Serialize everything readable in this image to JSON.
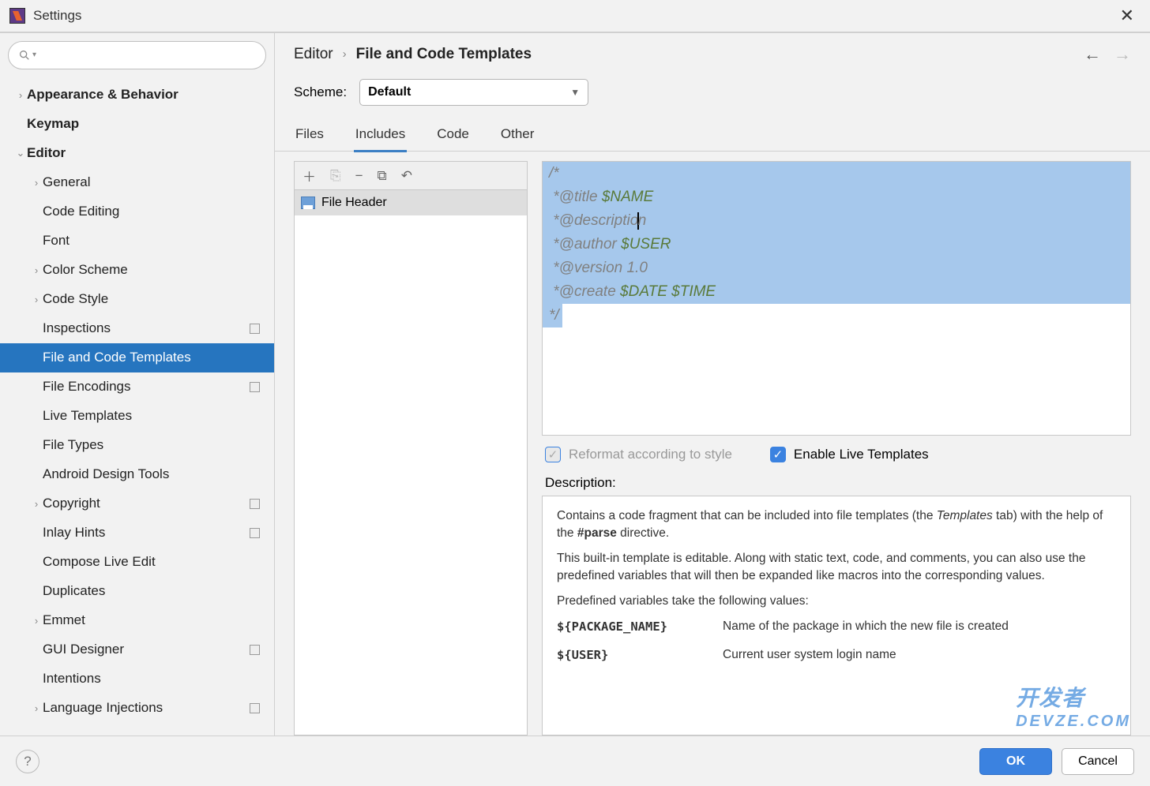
{
  "window": {
    "title": "Settings"
  },
  "search": {
    "placeholder": ""
  },
  "sidebar": {
    "items": [
      {
        "label": "Appearance & Behavior",
        "level": 0,
        "bold": true,
        "arrow": "›",
        "name": "appearance-behavior"
      },
      {
        "label": "Keymap",
        "level": 0,
        "bold": true,
        "arrow": "",
        "name": "keymap"
      },
      {
        "label": "Editor",
        "level": 0,
        "bold": true,
        "arrow": "⌄",
        "name": "editor"
      },
      {
        "label": "General",
        "level": 1,
        "arrow": "›",
        "name": "general"
      },
      {
        "label": "Code Editing",
        "level": 1,
        "arrow": "",
        "name": "code-editing"
      },
      {
        "label": "Font",
        "level": 1,
        "arrow": "",
        "name": "font"
      },
      {
        "label": "Color Scheme",
        "level": 1,
        "arrow": "›",
        "name": "color-scheme"
      },
      {
        "label": "Code Style",
        "level": 1,
        "arrow": "›",
        "name": "code-style"
      },
      {
        "label": "Inspections",
        "level": 1,
        "arrow": "",
        "badge": true,
        "name": "inspections"
      },
      {
        "label": "File and Code Templates",
        "level": 1,
        "arrow": "",
        "selected": true,
        "name": "file-code-templates"
      },
      {
        "label": "File Encodings",
        "level": 1,
        "arrow": "",
        "badge": true,
        "name": "file-encodings"
      },
      {
        "label": "Live Templates",
        "level": 1,
        "arrow": "",
        "name": "live-templates"
      },
      {
        "label": "File Types",
        "level": 1,
        "arrow": "",
        "name": "file-types"
      },
      {
        "label": "Android Design Tools",
        "level": 1,
        "arrow": "",
        "name": "android-design-tools"
      },
      {
        "label": "Copyright",
        "level": 1,
        "arrow": "›",
        "badge": true,
        "name": "copyright"
      },
      {
        "label": "Inlay Hints",
        "level": 1,
        "arrow": "",
        "badge": true,
        "name": "inlay-hints"
      },
      {
        "label": "Compose Live Edit",
        "level": 1,
        "arrow": "",
        "name": "compose-live-edit"
      },
      {
        "label": "Duplicates",
        "level": 1,
        "arrow": "",
        "name": "duplicates"
      },
      {
        "label": "Emmet",
        "level": 1,
        "arrow": "›",
        "name": "emmet"
      },
      {
        "label": "GUI Designer",
        "level": 1,
        "arrow": "",
        "badge": true,
        "name": "gui-designer"
      },
      {
        "label": "Intentions",
        "level": 1,
        "arrow": "",
        "name": "intentions"
      },
      {
        "label": "Language Injections",
        "level": 1,
        "arrow": "›",
        "badge": true,
        "name": "language-injections"
      }
    ]
  },
  "breadcrumb": {
    "root": "Editor",
    "current": "File and Code Templates"
  },
  "scheme": {
    "label": "Scheme:",
    "value": "Default"
  },
  "tabs": [
    "Files",
    "Includes",
    "Code",
    "Other"
  ],
  "active_tab": 1,
  "template_list": {
    "items": [
      "File Header"
    ]
  },
  "editor": {
    "lines": [
      {
        "t": "/*"
      },
      {
        "t": " *@title ",
        "v": "$NAME"
      },
      {
        "t": " *@descriptio",
        "cursor": true,
        "t2": "n"
      },
      {
        "t": " *@author ",
        "v": "$USER"
      },
      {
        "t": " *@version 1.0"
      },
      {
        "t": " *@create ",
        "v": "$DATE $TIME"
      }
    ],
    "last": "*/"
  },
  "checks": {
    "reformat": "Reformat according to style",
    "enable_live": "Enable Live Templates"
  },
  "description": {
    "label": "Description:",
    "p1a": "Contains a code fragment that can be included into file templates (the ",
    "p1b": "Templates",
    "p1c": " tab) with the help of the ",
    "p1d": "#parse",
    "p1e": " directive.",
    "p2": "This built-in template is editable. Along with static text, code, and comments, you can also use the predefined variables that will then be expanded like macros into the corresponding values.",
    "p3": "Predefined variables take the following values:",
    "vars": [
      {
        "k": "${PACKAGE_NAME}",
        "v": "Name of the package in which the new file is created"
      },
      {
        "k": "${USER}",
        "v": "Current user system login name"
      }
    ]
  },
  "footer": {
    "ok": "OK",
    "cancel": "Cancel"
  },
  "watermark": {
    "line1": "开发者",
    "line2": "DEVZE.COM"
  }
}
